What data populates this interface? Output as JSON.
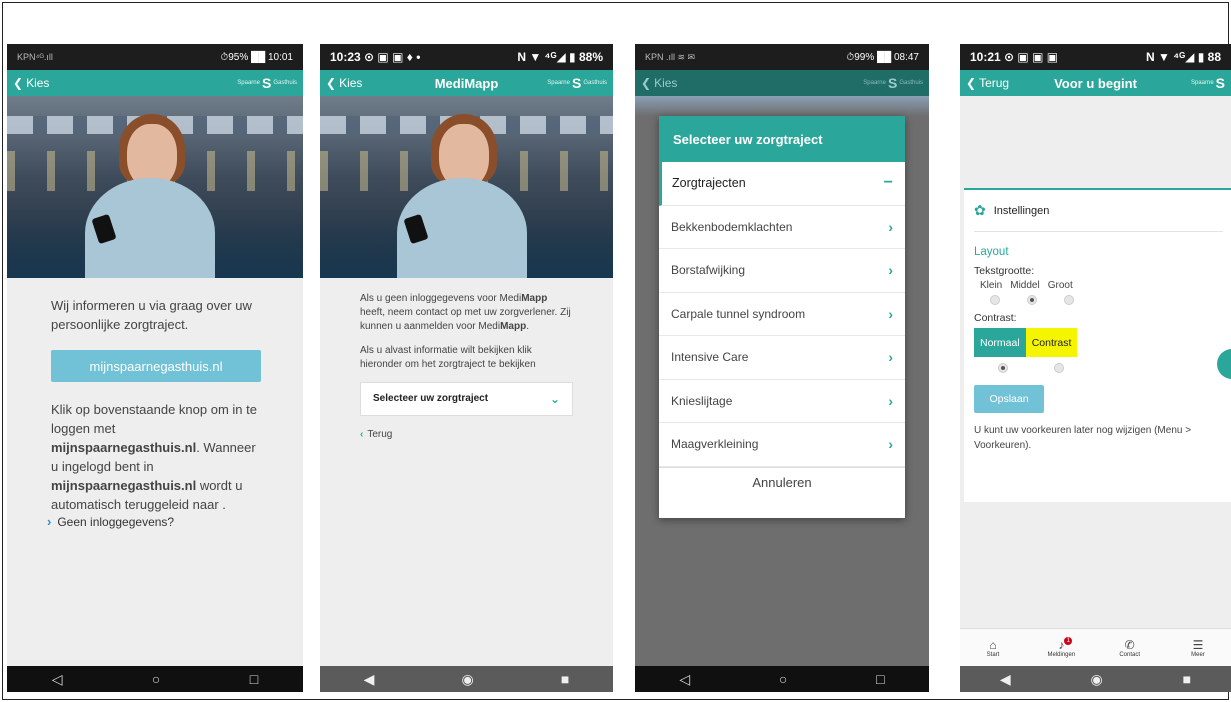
{
  "phone1": {
    "status": {
      "carrier": "KPN⁴ᴳ.ıll",
      "right": "⏱95% ██ 10:01"
    },
    "appbar": {
      "back_label": "Kies",
      "brand_small": "Spaarne",
      "brand_letter": "S",
      "brand_tail": "Gasthuis"
    },
    "intro": "Wij informeren u via graag over uw persoonlijke zorgtraject.",
    "button_label": "mijnspaarnegasthuis.nl",
    "body_a": "Klik op bovenstaande knop om in te loggen met ",
    "body_b": "mijnspaarnegasthuis.nl",
    "body_c": ". Wanneer u ingelogd bent in ",
    "body_d": "mijnspaarnegasthuis.nl",
    "body_e": " wordt u automatisch teruggeleid naar .",
    "link_label": "Geen inloggegevens?"
  },
  "phone2": {
    "status": {
      "left": "10:23 ⊙ ▣ ▣ ♦ •",
      "right": "N ▼ ⁴ᴳ◢ ▮ 88%"
    },
    "appbar": {
      "back_label": "Kies",
      "title": "MediMapp",
      "brand_small": "Spaarne",
      "brand_letter": "S",
      "brand_tail": "Gasthuis"
    },
    "para1_a": "Als u geen inloggegevens voor Medi",
    "para1_b": "Mapp",
    "para1_c": " heeft, neem contact op met uw zorgverlener. Zij kunnen u aanmelden voor Medi",
    "para1_d": "Mapp",
    "para1_e": ".",
    "para2": "Als u alvast informatie wilt bekijken klik hieronder om het zorgtraject te bekijken",
    "select_label": "Selecteer uw zorgtraject",
    "back_label": "Terug"
  },
  "phone3": {
    "status": {
      "carrier": "KPN .ıll ≋ ✉",
      "right": "⏱99% ██ 08:47"
    },
    "appbar": {
      "back_label": "Kies",
      "brand_small": "Spaarne",
      "brand_letter": "S",
      "brand_tail": "Gasthuis"
    },
    "modal_title": "Selecteer uw zorgtraject",
    "group_label": "Zorgtrajecten",
    "items": [
      "Bekkenbodemklachten",
      "Borstafwijking",
      "Carpale tunnel syndroom",
      "Intensive Care",
      "Knieslijtage",
      "Maagverkleining"
    ],
    "cancel_label": "Annuleren"
  },
  "phone4": {
    "status": {
      "left": "10:21 ⊙ ▣ ▣ ▣",
      "right": "N ▼ ⁴ᴳ◢ ▮ 88"
    },
    "appbar": {
      "back_label": "Terug",
      "title": "Voor u begint",
      "brand_small": "Spaarne",
      "brand_letter": "S"
    },
    "card_title": "Instellingen",
    "section": "Layout",
    "text_size_label": "Tekstgrootte:",
    "text_sizes": [
      "Klein",
      "Middel",
      "Groot"
    ],
    "contrast_label": "Contrast:",
    "contrast_normal": "Normaal",
    "contrast_contrast": "Contrast",
    "save_label": "Opslaan",
    "note": "U kunt uw voorkeuren later nog wijzigen (Menu > Voorkeuren).",
    "tabs": {
      "start": "Start",
      "alerts": "Meldingen",
      "alerts_badge": "1",
      "contact": "Contact",
      "more": "Meer"
    }
  },
  "colors": {
    "teal": "#2aa79a",
    "light_blue_button": "#71c2d6",
    "contrast_yellow": "#f5f500"
  }
}
